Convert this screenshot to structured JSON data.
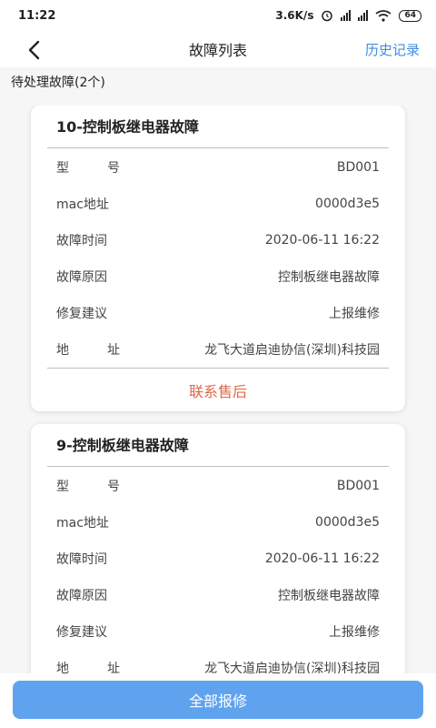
{
  "status_bar": {
    "time": "11:22",
    "network_speed": "3.6K/s",
    "battery": "64",
    "icons": [
      "alarm-icon",
      "signal-icon",
      "signal-icon",
      "wifi-icon",
      "battery-icon"
    ]
  },
  "nav": {
    "title": "故障列表",
    "history_label": "历史记录",
    "back_icon": "chevron-left-icon"
  },
  "section": {
    "pending_label": "待处理故障(2个)"
  },
  "faults": [
    {
      "title": "10-控制板继电器故障",
      "fields": [
        {
          "label_chars": [
            "型",
            "号"
          ],
          "value": "BD001"
        },
        {
          "label": "mac地址",
          "value": "0000d3e5"
        },
        {
          "label": "故障时间",
          "value": "2020-06-11 16:22"
        },
        {
          "label": "故障原因",
          "value": "控制板继电器故障"
        },
        {
          "label": "修复建议",
          "value": "上报维修"
        },
        {
          "label_chars": [
            "地",
            "址"
          ],
          "value": "龙飞大道启迪协信(深圳)科技园"
        }
      ],
      "contact_label": "联系售后"
    },
    {
      "title": "9-控制板继电器故障",
      "fields": [
        {
          "label_chars": [
            "型",
            "号"
          ],
          "value": "BD001"
        },
        {
          "label": "mac地址",
          "value": "0000d3e5"
        },
        {
          "label": "故障时间",
          "value": "2020-06-11 16:22"
        },
        {
          "label": "故障原因",
          "value": "控制板继电器故障"
        },
        {
          "label": "修复建议",
          "value": "上报维修"
        },
        {
          "label_chars": [
            "地",
            "址"
          ],
          "value": "龙飞大道启迪协信(深圳)科技园"
        }
      ]
    }
  ],
  "bottom": {
    "repair_all_label": "全部报修"
  },
  "colors": {
    "accent_blue": "#3a8ee6",
    "button_blue": "#5fa3ee",
    "contact_orange": "#dd6a4a"
  }
}
